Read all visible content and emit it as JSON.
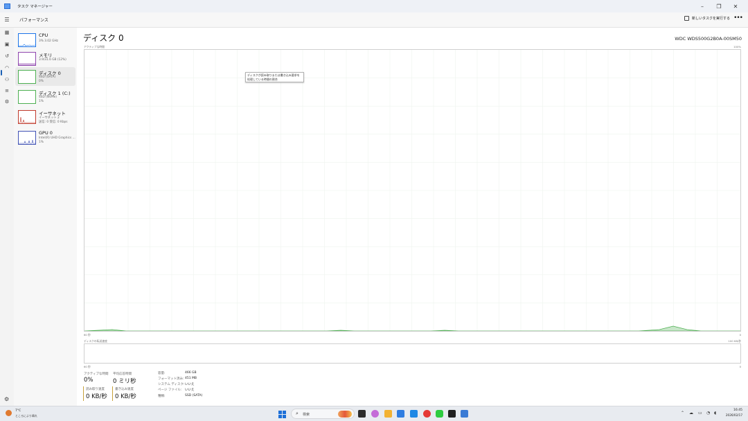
{
  "window": {
    "title": "タスク マネージャー"
  },
  "header": {
    "section_title": "パフォーマンス",
    "run_task_label": "新しいタスクを実行する",
    "more_label": "•••"
  },
  "sidebar": {
    "items": [
      {
        "name": "CPU",
        "line1": "3%  3.02 GHz",
        "line2": ""
      },
      {
        "name": "メモリ",
        "line1": "3.9/31.6 GB (12%)",
        "line2": ""
      },
      {
        "name": "ディスク 0",
        "line1": "SSD (SATA)",
        "line2": "0%"
      },
      {
        "name": "ディスク 1 (C:)",
        "line1": "SSD (NVMe)",
        "line2": "1%"
      },
      {
        "name": "イーサネット",
        "line1": "イーサネット 2",
        "line2": "送信: 0  受信: 0 Kbps"
      },
      {
        "name": "GPU 0",
        "line1": "Intel(R) UHD Graphics ...",
        "line2": "1%"
      }
    ]
  },
  "main": {
    "title": "ディスク 0",
    "model": "WDC  WDS500G2B0A-00SM50",
    "graph1": {
      "label": "アクティブな時間",
      "max": "100%",
      "xleft": "60 秒",
      "xright": "0"
    },
    "graph2": {
      "label": "ディスクの転送速度",
      "max": "100 KB/秒",
      "xleft": "60 秒",
      "xright": "0"
    },
    "tooltip": {
      "line1": "ディスクが読み取りまたは書き込み要求を",
      "line2": "処理している時間の割合"
    },
    "stats": {
      "active_time_label": "アクティブな時間",
      "active_time_value": "0%",
      "avg_response_label": "平均応答時間",
      "avg_response_value": "0 ミリ秒",
      "read_speed_label": "読み取り速度",
      "read_speed_value": "0 KB/秒",
      "write_speed_label": "書き込み速度",
      "write_speed_value": "0 KB/秒"
    },
    "properties": [
      {
        "label": "容量:",
        "value": "466 GB"
      },
      {
        "label": "フォーマット済み:",
        "value": "451 MB"
      },
      {
        "label": "システム ディスク:",
        "value": "いいえ"
      },
      {
        "label": "ページ ファイル:",
        "value": "いいえ"
      },
      {
        "label": "種類:",
        "value": "SSD (SATA)"
      }
    ]
  },
  "taskbar": {
    "weather_line1": "7°C",
    "weather_line2": "ところにより晴れ",
    "search_placeholder": "検索",
    "time": "16:45",
    "date": "2026/02/17"
  },
  "colors": {
    "disk": "#4caf50",
    "cpu": "#1a73e8",
    "memory": "#8e44ad",
    "ethernet": "#c0392b",
    "gpu": "#3f51b5"
  }
}
